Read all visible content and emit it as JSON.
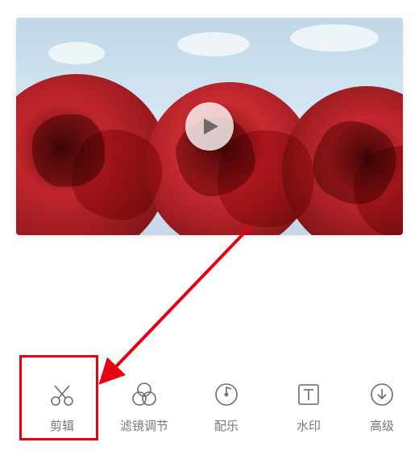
{
  "preview": {
    "play_icon_name": "play-icon"
  },
  "toolbar": {
    "items": [
      {
        "key": "edit",
        "label": "剪辑",
        "icon": "scissors-icon"
      },
      {
        "key": "filter",
        "label": "滤镜调节",
        "icon": "filter-icon"
      },
      {
        "key": "music",
        "label": "配乐",
        "icon": "music-icon"
      },
      {
        "key": "watermark",
        "label": "水印",
        "icon": "text-icon"
      },
      {
        "key": "advanced",
        "label": "高级",
        "icon": "download-icon"
      }
    ]
  },
  "annotation": {
    "highlighted_tool_key": "edit",
    "highlight_color": "#e60012"
  }
}
